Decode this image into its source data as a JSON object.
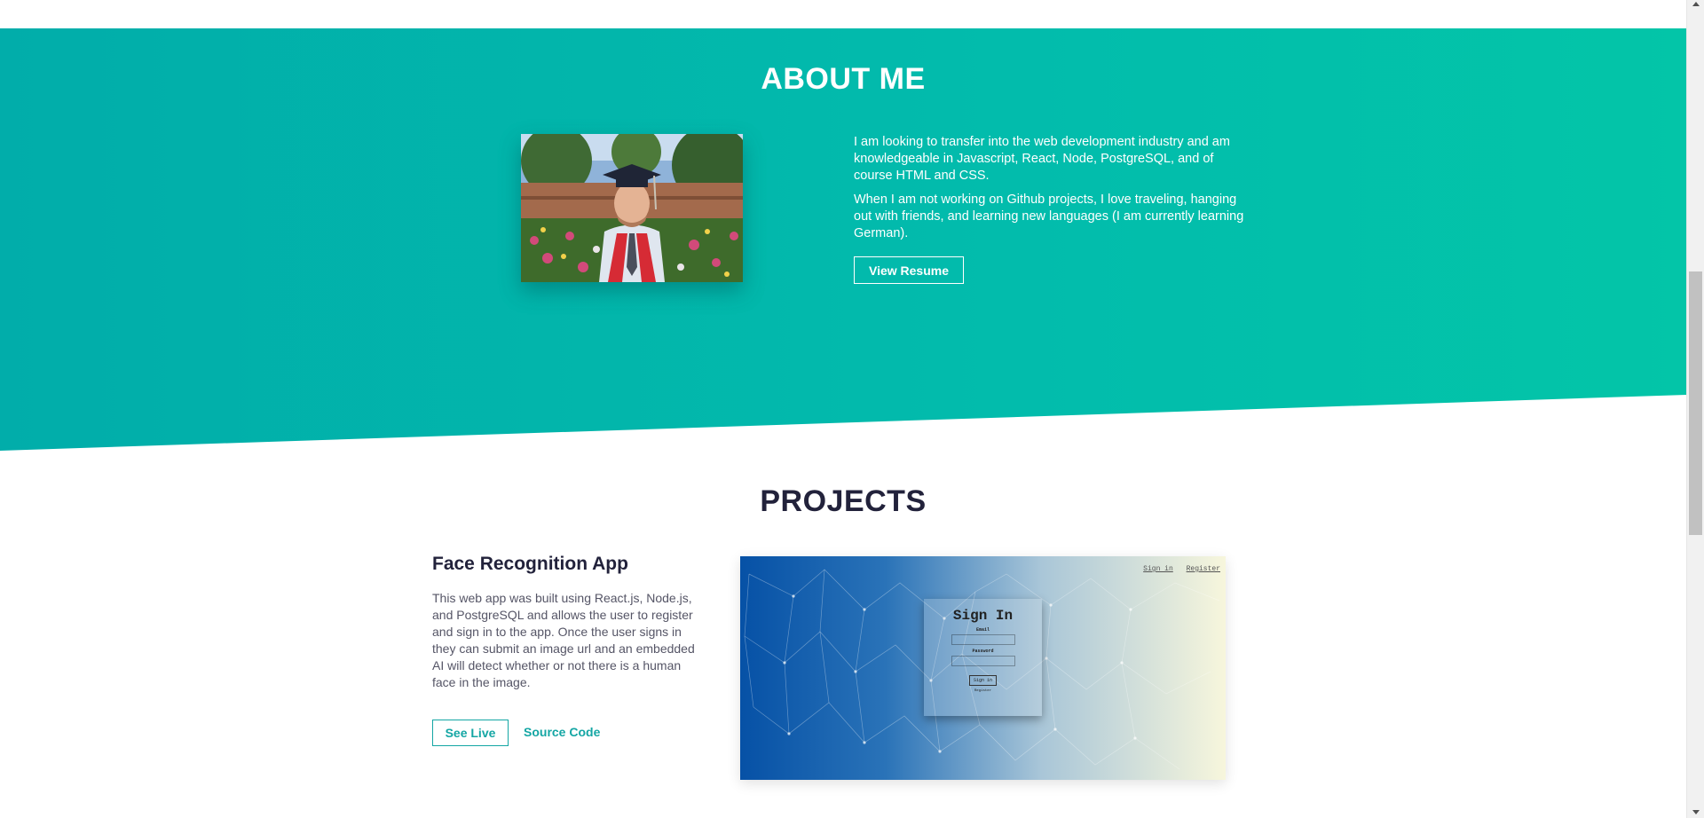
{
  "about": {
    "title": "ABOUT ME",
    "paragraph1": "I am looking to transfer into the web development industry and am knowledgeable in Javascript, React, Node, PostgreSQL, and of course HTML and CSS.",
    "paragraph2": "When I am not working on Github projects, I love traveling, hanging out with friends, and learning new languages (I am currently learning German).",
    "resume_button": "View Resume",
    "colors": {
      "gradient_start": "#01adaa",
      "gradient_end": "#03c5a8"
    }
  },
  "projects": {
    "title": "PROJECTS",
    "items": [
      {
        "name": "Face Recognition App",
        "description": "This web app was built using React.js, Node.js, and PostgreSQL and allows the user to register and sign in to the app. Once the user signs in they can submit an image url and an embedded AI will detect whether or not there is a human face in the image.",
        "see_live_label": "See Live",
        "source_code_label": "Source Code",
        "screenshot": {
          "signin_link": "Sign in",
          "register_link": "Register",
          "card_title": "Sign In",
          "email_label": "Email",
          "password_label": "Password",
          "submit_label": "Sign in",
          "register_text": "Register"
        }
      }
    ],
    "colors": {
      "heading": "#22223b",
      "accent": "#14a6a4"
    }
  }
}
